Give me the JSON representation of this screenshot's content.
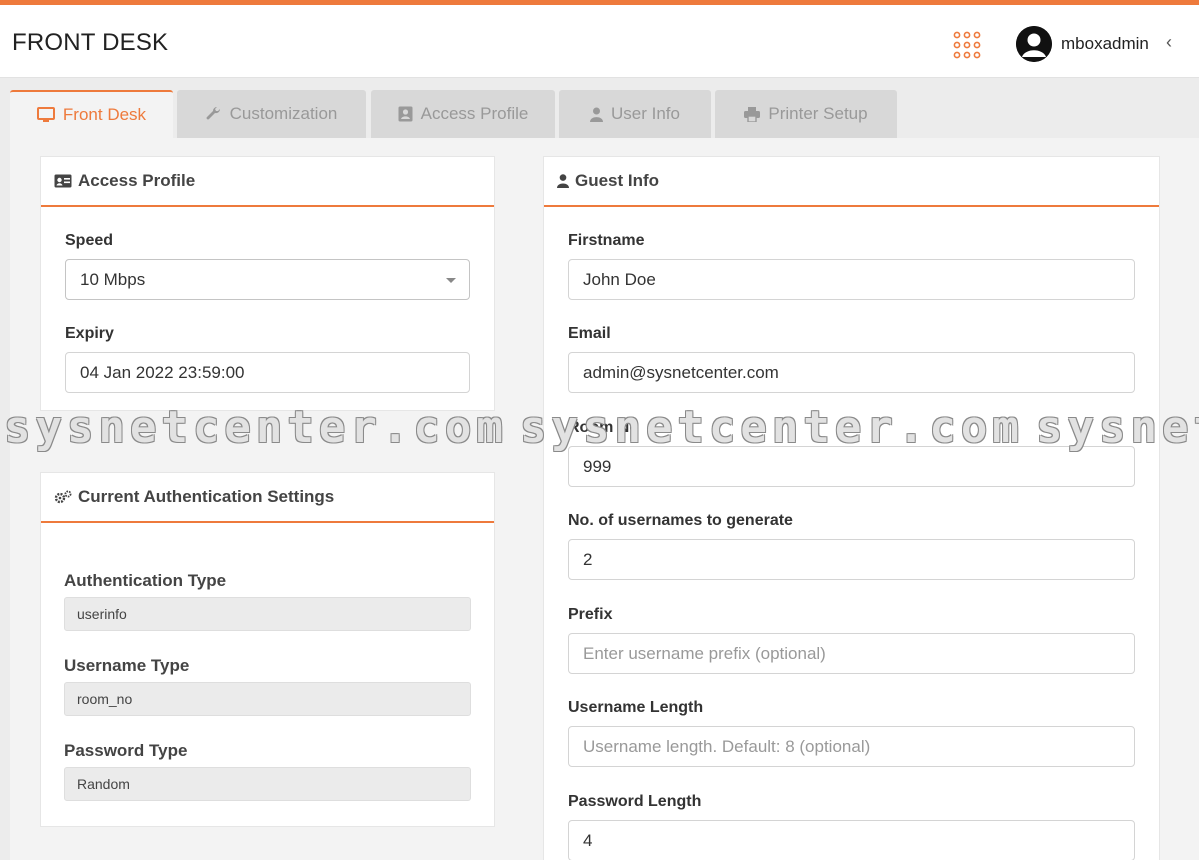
{
  "header": {
    "title": "FRONT DESK",
    "username": "mboxadmin",
    "collapse_glyph": "‹",
    "apps_icon": "grid-dots-icon",
    "accent_color": "#ee7a3c"
  },
  "tabs": [
    {
      "label": "Front Desk",
      "icon": "monitor-icon",
      "active": true
    },
    {
      "label": "Customization",
      "icon": "wrench-icon",
      "active": false
    },
    {
      "label": "Access Profile",
      "icon": "id-card-icon",
      "active": false
    },
    {
      "label": "User Info",
      "icon": "user-icon",
      "active": false
    },
    {
      "label": "Printer Setup",
      "icon": "printer-icon",
      "active": false
    }
  ],
  "access_profile": {
    "title": "Access Profile",
    "speed_label": "Speed",
    "speed_value": "10 Mbps",
    "expiry_label": "Expiry",
    "expiry_value": "04 Jan 2022 23:59:00"
  },
  "auth_settings": {
    "title": "Current Authentication Settings",
    "auth_type_label": "Authentication Type",
    "auth_type_value": "userinfo",
    "username_type_label": "Username Type",
    "username_type_value": "room_no",
    "password_type_label": "Password Type",
    "password_type_value": "Random"
  },
  "guest_info": {
    "title": "Guest Info",
    "firstname_label": "Firstname",
    "firstname_value": "John Doe",
    "email_label": "Email",
    "email_value": "admin@sysnetcenter.com",
    "room_label": "Room No",
    "room_value": "999",
    "count_label": "No. of usernames to generate",
    "count_value": "2",
    "prefix_label": "Prefix",
    "prefix_placeholder": "Enter username prefix (optional)",
    "ulen_label": "Username Length",
    "ulen_placeholder": "Username length. Default: 8 (optional)",
    "plen_label": "Password Length",
    "plen_value": "4"
  },
  "watermark": {
    "text": "sysnetcenter.com"
  }
}
